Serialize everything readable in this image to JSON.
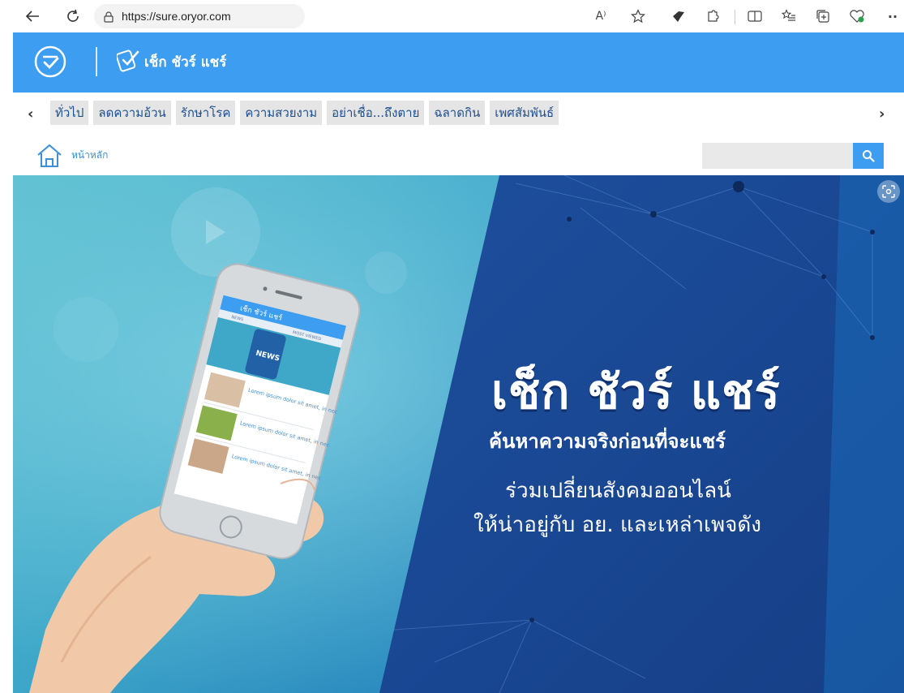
{
  "browser": {
    "url": "https://sure.oryor.com",
    "icons": [
      "back-icon",
      "refresh-icon",
      "lock-icon",
      "read-aloud-icon",
      "favorite-star-icon",
      "extension-icon",
      "puzzle-icon",
      "split-screen-icon",
      "favorites-list-icon",
      "collections-icon",
      "performance-icon",
      "more-icon"
    ],
    "read_aloud_glyph": "A⁾",
    "more_glyph": "··"
  },
  "header": {
    "brand": "เช็ก ชัวร์ แชร์",
    "background_color": "#3d9df0"
  },
  "categories": [
    "ทั่วไป",
    "ลดความอ้วน",
    "รักษาโรค",
    "ความสวยงาม",
    "อย่าเชื่อ...ถึงตาย",
    "ฉลาดกิน",
    "เพศสัมพันธ์"
  ],
  "breadcrumb": {
    "home_label": "หน้าหลัก"
  },
  "search": {
    "placeholder": ""
  },
  "hero": {
    "title": "เช็ก ชัวร์ แชร์",
    "subtitle": "ค้นหาความจริงก่อนที่จะแชร์",
    "line1": "ร่วมเปลี่ยนสังคมออนไลน์",
    "line2": "ให้น่าอยู่กับ อย. และเหล่าเพจดัง",
    "phone": {
      "brand": "เช็ก ชัวร์ แชร์",
      "tab_left": "NEWS",
      "tab_right": "MOST VIEWED",
      "banner": "NEWS",
      "item_text_1": "Lorem ipsum dolor sit amet, in nec",
      "item_text_2": "Lorem ipsum dolor sit amet, in nec",
      "item_text_3": "Lorem ipsum dolor sit amet, in nec"
    }
  }
}
